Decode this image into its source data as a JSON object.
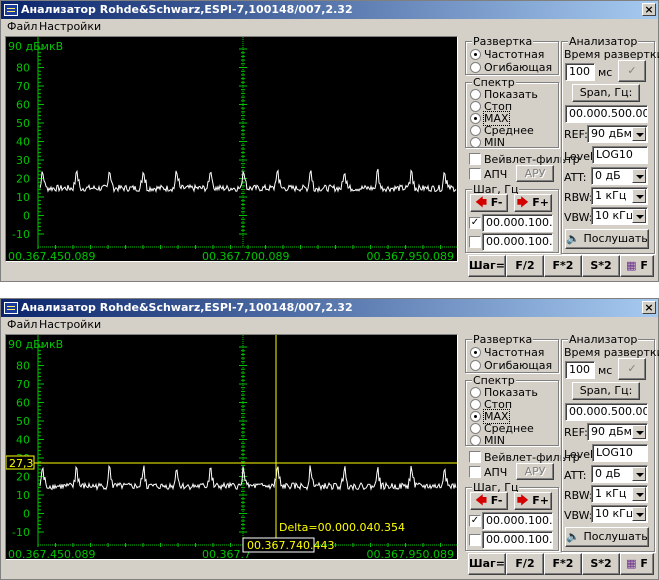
{
  "windows": [
    {
      "title": "Анализатор Rohde&Schwarz,ESPI-7,100148/007,2.32",
      "close": "×",
      "menu": [
        "Файл",
        "Настройки"
      ],
      "plot": {
        "unit_label": "90 дБмкВ",
        "y_ticks": [
          "80",
          "70",
          "60",
          "50",
          "40",
          "30",
          "20",
          "10",
          "0",
          "-10"
        ],
        "x_ticks": [
          "00.367.450.089",
          "00.367.700.089",
          "00.367.950.089"
        ],
        "markers": null
      },
      "panel": {
        "sweep": {
          "title": "Развертка",
          "options": [
            "Частотная",
            "Огибающая"
          ],
          "selected": 0
        },
        "spectrum": {
          "title": "Спектр",
          "options": [
            "Показать",
            "Стоп",
            "MAX",
            "Среднее",
            "MIN"
          ],
          "selected": 2
        },
        "wavelet": "Вейвлет-фильтр",
        "apch": "АПЧ",
        "aru": "АРУ",
        "step_title": "Шаг, Гц",
        "f_minus": "F-",
        "f_plus": "F+",
        "step1": "00.000.100.000",
        "step2": "00.000.100.000",
        "analyzer": {
          "title": "Анализатор",
          "sweep_time_label": "Время развертки:",
          "sweep_time": "100",
          "sweep_unit": "мс",
          "span_button": "Span, Гц:",
          "span_value": "00.000.500.000",
          "ref_label": "REF:",
          "ref_value": "90 дБмкВ",
          "level_label": "Level:",
          "level_value": "LOG10",
          "att_label": "ATT:",
          "att_value": "0 дБ",
          "rbw_label": "RBW:",
          "rbw_value": "1 кГц",
          "vbw_label": "VBW:",
          "vbw_value": "10 кГц",
          "listen": "Послушать"
        },
        "bottom_buttons": [
          "Шаг=F",
          "F/2",
          "F*2",
          "S*2",
          "F"
        ]
      }
    },
    {
      "title": "Анализатор Rohde&Schwarz,ESPI-7,100148/007,2.32",
      "close": "×",
      "menu": [
        "Файл",
        "Настройки"
      ],
      "plot": {
        "unit_label": "90 дБмкВ",
        "y_ticks": [
          "80",
          "70",
          "60",
          "50",
          "40",
          "30",
          "20",
          "10",
          "0",
          "-10"
        ],
        "x_ticks": [
          "00.367.450.089",
          "00.367.7",
          "00.367.950.089"
        ],
        "markers": {
          "level": "27,3",
          "delta": "Delta=00.000.040.354",
          "freq": "00.367.740.443"
        }
      },
      "panel": {
        "sweep": {
          "title": "Развертка",
          "options": [
            "Частотная",
            "Огибающая"
          ],
          "selected": 0
        },
        "spectrum": {
          "title": "Спектр",
          "options": [
            "Показать",
            "Стоп",
            "MAX",
            "Среднее",
            "MIN"
          ],
          "selected": 2
        },
        "wavelet": "Вейвлет-фильтр",
        "apch": "АПЧ",
        "aru": "АРУ",
        "step_title": "Шаг, Гц",
        "f_minus": "F-",
        "f_plus": "F+",
        "step1": "00.000.100.000",
        "step2": "00.000.100.000",
        "analyzer": {
          "title": "Анализатор",
          "sweep_time_label": "Время развертки:",
          "sweep_time": "100",
          "sweep_unit": "мс",
          "span_button": "Span, Гц:",
          "span_value": "00.000.500.000",
          "ref_label": "REF:",
          "ref_value": "90 дБмкВ",
          "level_label": "Level:",
          "level_value": "LOG10",
          "att_label": "ATT:",
          "att_value": "0 дБ",
          "rbw_label": "RBW:",
          "rbw_value": "1 кГц",
          "vbw_label": "VBW:",
          "vbw_value": "10 кГц",
          "listen": "Послушать"
        },
        "bottom_buttons": [
          "Шаг=F",
          "F/2",
          "F*2",
          "S*2",
          "F"
        ]
      }
    }
  ],
  "colors": {
    "trace": "#ffffff",
    "grid": "#00c400",
    "marker": "#ffff00"
  }
}
